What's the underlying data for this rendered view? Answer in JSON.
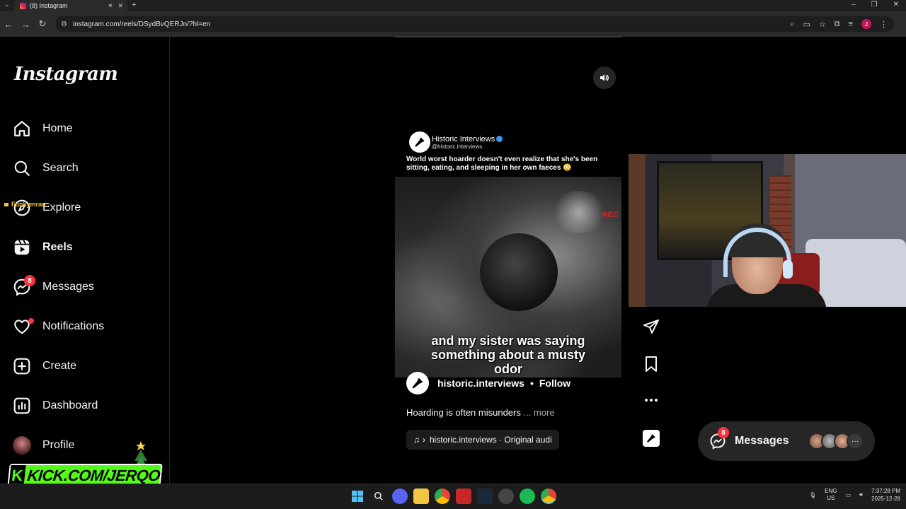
{
  "browser": {
    "tab_title": "(8) Instagram",
    "url": "instagram.com/reels/DSydBvQERJn/?hl=en",
    "profile_initial": "J"
  },
  "sidebar": {
    "logo": "Instagram",
    "items": [
      {
        "label": "Home",
        "icon": "home-icon"
      },
      {
        "label": "Search",
        "icon": "search-icon"
      },
      {
        "label": "Explore",
        "icon": "compass-icon"
      },
      {
        "label": "Reels",
        "icon": "reels-icon"
      },
      {
        "label": "Messages",
        "icon": "messenger-icon",
        "badge": "8"
      },
      {
        "label": "Notifications",
        "icon": "heart-icon"
      },
      {
        "label": "Create",
        "icon": "plus-square-icon"
      },
      {
        "label": "Dashboard",
        "icon": "dashboard-icon"
      },
      {
        "label": "Profile",
        "icon": "profile-avatar"
      }
    ]
  },
  "chat_overlay": "Funkymran :",
  "kick": {
    "letter": "K",
    "text": "KICK.COM/JERQO"
  },
  "reel": {
    "source_name": "Historic Interviews",
    "source_handle": "@historic.interviews",
    "caption_top": "World worst hoarder doesn't even realize that she's been sitting, eating, and sleeping in her own faeces 😳",
    "rec_label": "REC",
    "subtitle_lines": [
      "and my sister was saying",
      "something about a musty",
      "odor"
    ],
    "author": "historic.interviews",
    "separator": "•",
    "follow": "Follow",
    "description": "Hoarding is often misunders",
    "more": "... more",
    "audio_separator": "›",
    "audio": "historic.interviews · Original audi"
  },
  "messages_pill": {
    "label": "Messages",
    "badge": "8",
    "more": "···"
  },
  "taskbar": {
    "lang_line1": "ENG",
    "lang_line2": "US",
    "time": "7:37:28 PM",
    "date": "2025-12-28"
  },
  "colors": {
    "badge_red": "#ff3040",
    "kick_green": "#53fc18",
    "bg": "#000000"
  }
}
